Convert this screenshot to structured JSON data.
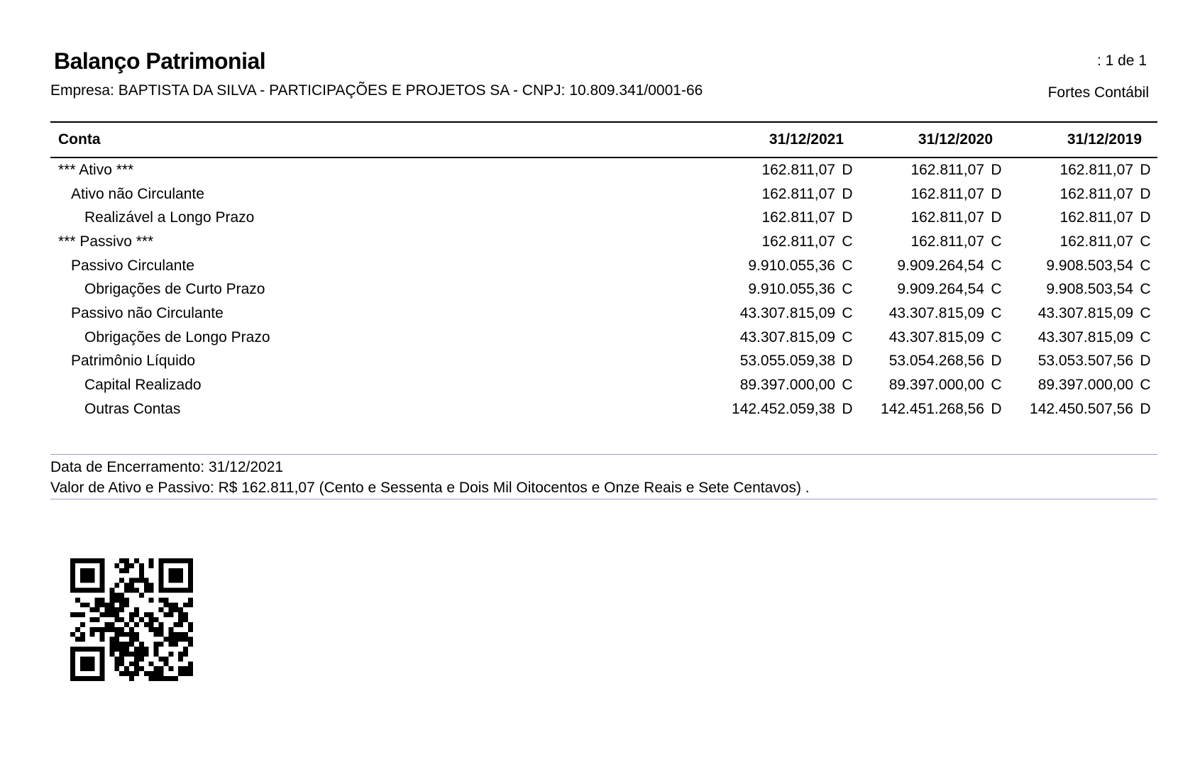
{
  "header": {
    "title": "Balanço Patrimonial",
    "page_info": ": 1 de 1",
    "company": "Empresa: BAPTISTA DA SILVA - PARTICIPAÇÕES E PROJETOS SA  - CNPJ: 10.809.341/0001-66",
    "system": "Fortes Contábil"
  },
  "table": {
    "columns": [
      "Conta",
      "31/12/2021",
      "31/12/2020",
      "31/12/2019"
    ],
    "rows": [
      {
        "account": "*** Ativo ***",
        "level": 0,
        "values": [
          [
            "162.811,07",
            "D"
          ],
          [
            "162.811,07",
            "D"
          ],
          [
            "162.811,07",
            "D"
          ]
        ]
      },
      {
        "account": "Ativo não Circulante",
        "level": 1,
        "values": [
          [
            "162.811,07",
            "D"
          ],
          [
            "162.811,07",
            "D"
          ],
          [
            "162.811,07",
            "D"
          ]
        ]
      },
      {
        "account": "Realizável a Longo Prazo",
        "level": 2,
        "values": [
          [
            "162.811,07",
            "D"
          ],
          [
            "162.811,07",
            "D"
          ],
          [
            "162.811,07",
            "D"
          ]
        ]
      },
      {
        "account": "*** Passivo ***",
        "level": 0,
        "values": [
          [
            "162.811,07",
            "C"
          ],
          [
            "162.811,07",
            "C"
          ],
          [
            "162.811,07",
            "C"
          ]
        ]
      },
      {
        "account": "Passivo Circulante",
        "level": 1,
        "values": [
          [
            "9.910.055,36",
            "C"
          ],
          [
            "9.909.264,54",
            "C"
          ],
          [
            "9.908.503,54",
            "C"
          ]
        ]
      },
      {
        "account": "Obrigações de Curto Prazo",
        "level": 2,
        "values": [
          [
            "9.910.055,36",
            "C"
          ],
          [
            "9.909.264,54",
            "C"
          ],
          [
            "9.908.503,54",
            "C"
          ]
        ]
      },
      {
        "account": "Passivo não Circulante",
        "level": 1,
        "values": [
          [
            "43.307.815,09",
            "C"
          ],
          [
            "43.307.815,09",
            "C"
          ],
          [
            "43.307.815,09",
            "C"
          ]
        ]
      },
      {
        "account": "Obrigações de Longo Prazo",
        "level": 2,
        "values": [
          [
            "43.307.815,09",
            "C"
          ],
          [
            "43.307.815,09",
            "C"
          ],
          [
            "43.307.815,09",
            "C"
          ]
        ]
      },
      {
        "account": "Patrimônio Líquido",
        "level": 1,
        "values": [
          [
            "53.055.059,38",
            "D"
          ],
          [
            "53.054.268,56",
            "D"
          ],
          [
            "53.053.507,56",
            "D"
          ]
        ]
      },
      {
        "account": "Capital Realizado",
        "level": 2,
        "values": [
          [
            "89.397.000,00",
            "C"
          ],
          [
            "89.397.000,00",
            "C"
          ],
          [
            "89.397.000,00",
            "C"
          ]
        ]
      },
      {
        "account": "Outras Contas",
        "level": 2,
        "values": [
          [
            "142.452.059,38",
            "D"
          ],
          [
            "142.451.268,56",
            "D"
          ],
          [
            "142.450.507,56",
            "D"
          ]
        ]
      }
    ]
  },
  "footer": {
    "closing_date": "Data de Encerramento:  31/12/2021",
    "total_value": "Valor de Ativo e Passivo: R$ 162.811,07 (Cento e Sessenta e Dois Mil Oitocentos e Onze Reais e Sete Centavos) ."
  },
  "qr_code": {
    "icon": "qr-code-icon"
  }
}
